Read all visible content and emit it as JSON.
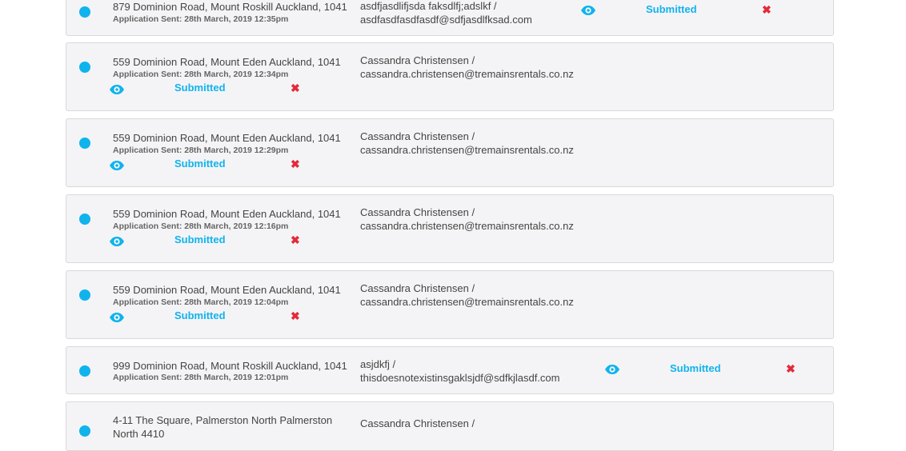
{
  "applications": [
    {
      "address": "879 Dominion Road, Mount Roskill Auckland, 1041",
      "sent": "Application Sent: 28th March, 2019 12:35pm",
      "contact_line1": "asdfjasdlifjsda faksdlfj;adslkf /",
      "contact_line2": "asdfasdfasdfasdf@sdfjasdlfksad.com",
      "status": "Submitted",
      "view_icon": "eye-icon",
      "delete_icon": "close-icon"
    },
    {
      "address": "559 Dominion Road, Mount Eden Auckland, 1041",
      "sent": "Application Sent: 28th March, 2019 12:34pm",
      "contact_line1": "Cassandra Christensen /",
      "contact_line2": "cassandra.christensen@tremainsrentals.co.nz",
      "status": "Submitted",
      "view_icon": "eye-icon",
      "delete_icon": "close-icon"
    },
    {
      "address": "559 Dominion Road, Mount Eden Auckland, 1041",
      "sent": "Application Sent: 28th March, 2019 12:29pm",
      "contact_line1": "Cassandra Christensen /",
      "contact_line2": "cassandra.christensen@tremainsrentals.co.nz",
      "status": "Submitted",
      "view_icon": "eye-icon",
      "delete_icon": "close-icon"
    },
    {
      "address": "559 Dominion Road, Mount Eden Auckland, 1041",
      "sent": "Application Sent: 28th March, 2019 12:16pm",
      "contact_line1": "Cassandra Christensen /",
      "contact_line2": "cassandra.christensen@tremainsrentals.co.nz",
      "status": "Submitted",
      "view_icon": "eye-icon",
      "delete_icon": "close-icon"
    },
    {
      "address": "559 Dominion Road, Mount Eden Auckland, 1041",
      "sent": "Application Sent: 28th March, 2019 12:04pm",
      "contact_line1": "Cassandra Christensen /",
      "contact_line2": "cassandra.christensen@tremainsrentals.co.nz",
      "status": "Submitted",
      "view_icon": "eye-icon",
      "delete_icon": "close-icon"
    },
    {
      "address": "999 Dominion Road, Mount Roskill Auckland, 1041",
      "sent": "Application Sent: 28th March, 2019 12:01pm",
      "contact_line1": "asjdkfj /",
      "contact_line2": "thisdoesnotexistinsgaklsjdf@sdfkjlasdf.com",
      "status": "Submitted",
      "view_icon": "eye-icon",
      "delete_icon": "close-icon"
    },
    {
      "address": "4-11 The Square, Palmerston North Palmerston",
      "address_line2": "North 4410",
      "contact_line1": "Cassandra Christensen /"
    }
  ],
  "colors": {
    "accent": "#11b3ec",
    "delete": "#e32a3a",
    "card_bg": "#f4f4f6",
    "card_border": "#d9d9dc"
  }
}
